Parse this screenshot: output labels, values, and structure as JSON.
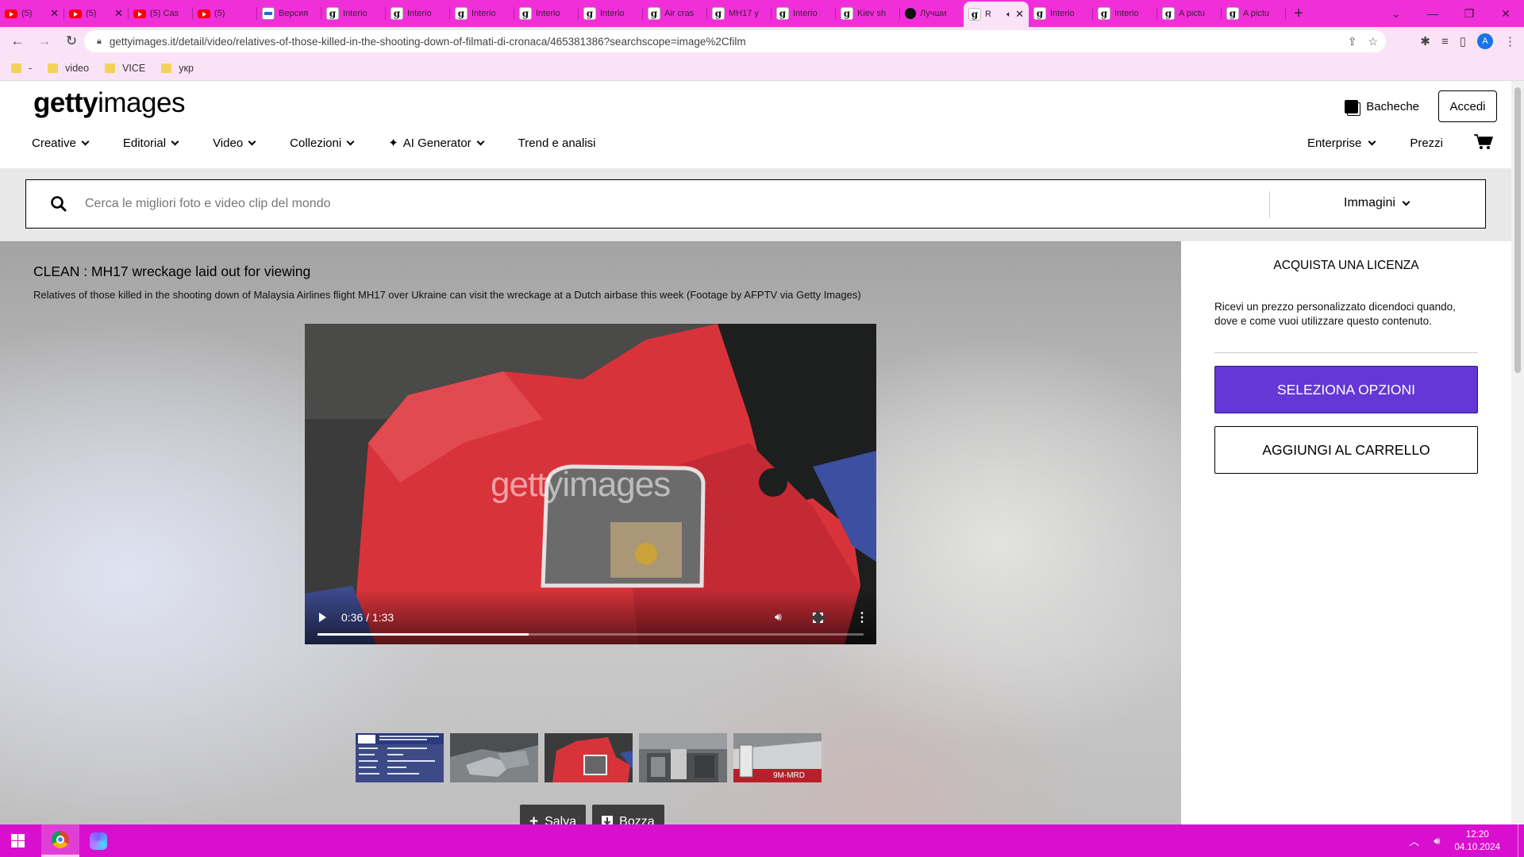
{
  "browser": {
    "tabs": [
      {
        "icon": "youtube-icon",
        "title": "(5)",
        "closable": true
      },
      {
        "icon": "youtube-icon",
        "title": "(5)",
        "closable": true
      },
      {
        "icon": "youtube-icon",
        "title": "(5) Cas",
        "closable": false
      },
      {
        "icon": "youtube-icon",
        "title": "(5)",
        "closable": false
      },
      {
        "icon": "ukrinform-icon",
        "title": "Версия",
        "closable": false
      },
      {
        "icon": "getty-icon",
        "title": "Interio",
        "closable": false
      },
      {
        "icon": "getty-icon",
        "title": "Interio",
        "closable": false
      },
      {
        "icon": "getty-icon",
        "title": "Interio",
        "closable": false
      },
      {
        "icon": "getty-icon",
        "title": "Interio",
        "closable": false
      },
      {
        "icon": "getty-icon",
        "title": "Interio",
        "closable": false
      },
      {
        "icon": "getty-icon",
        "title": "Air cras",
        "closable": false
      },
      {
        "icon": "getty-icon",
        "title": "MH17 y",
        "closable": false
      },
      {
        "icon": "getty-icon",
        "title": "Interio",
        "closable": false
      },
      {
        "icon": "getty-icon",
        "title": "Kiev sh",
        "closable": false
      },
      {
        "icon": "web-icon",
        "title": "Лучши",
        "closable": false
      },
      {
        "icon": "getty-icon",
        "title": "R",
        "closable": true,
        "active": true
      },
      {
        "icon": "getty-icon",
        "title": "Interio",
        "closable": false
      },
      {
        "icon": "getty-icon",
        "title": "Interio",
        "closable": false
      },
      {
        "icon": "getty-icon",
        "title": "A pictu",
        "closable": false
      },
      {
        "icon": "getty-icon",
        "title": "A pictu",
        "closable": false
      }
    ],
    "new_tab": "+",
    "url": "gettyimages.it/detail/video/relatives-of-those-killed-in-the-shooting-down-of-filmati-di-cronaca/465381386?searchscope=image%2Cfilm",
    "profile_initial": "A",
    "bookmarks": [
      {
        "label": "-"
      },
      {
        "label": "video"
      },
      {
        "label": "VICE"
      },
      {
        "label": "укр"
      }
    ]
  },
  "site": {
    "logo_bold": "getty",
    "logo_light": "images",
    "boards_label": "Bacheche",
    "login_label": "Accedi",
    "nav": [
      {
        "label": "Creative",
        "dropdown": true
      },
      {
        "label": "Editorial",
        "dropdown": true
      },
      {
        "label": "Video",
        "dropdown": true
      },
      {
        "label": "Collezioni",
        "dropdown": true
      },
      {
        "label": "AI Generator",
        "dropdown": true,
        "icon": "sparkle-icon"
      },
      {
        "label": "Trend e analisi",
        "dropdown": false
      }
    ],
    "nav_right": [
      {
        "label": "Enterprise",
        "dropdown": true
      },
      {
        "label": "Prezzi",
        "dropdown": false
      }
    ],
    "search_placeholder": "Cerca le migliori foto e video clip del mondo",
    "search_scope": "Immagini"
  },
  "asset": {
    "title": "CLEAN : MH17 wreckage laid out for viewing",
    "description": "Relatives of those killed in the shooting down of Malaysia Airlines flight MH17 over Ukraine can visit the wreckage at a Dutch airbase this week (Footage by AFPTV via Getty Images)",
    "watermark": "gettyimages",
    "time_display": "0:36 / 1:33",
    "progress": 0.387,
    "thumbnails": [
      {
        "name": "thumb-title-card"
      },
      {
        "name": "thumb-wreckage-floor"
      },
      {
        "name": "thumb-red-fuselage",
        "selected": true
      },
      {
        "name": "thumb-hangar"
      },
      {
        "name": "thumb-fuselage-9m-mrd",
        "text": "9M-MRD"
      }
    ],
    "save_label": "Salva",
    "draft_label": "Bozza"
  },
  "license": {
    "heading": "ACQUISTA UNA LICENZA",
    "text": "Ricevi un prezzo personalizzato dicendoci quando, dove e come vuoi utilizzare questo contenuto.",
    "select_label": "SELEZIONA OPZIONI",
    "cart_label": "AGGIUNGI AL CARRELLO",
    "select_color": "#6437d6"
  },
  "taskbar": {
    "time": "12:20",
    "date": "04.10.2024"
  }
}
